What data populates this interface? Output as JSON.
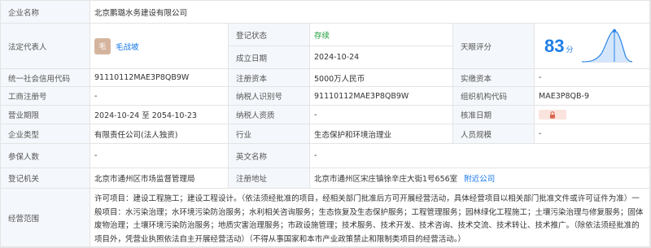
{
  "company": {
    "label": "企业名称",
    "name": "北京鹏璐水务建设有限公司"
  },
  "legal_rep": {
    "label": "法定代表人",
    "avatar_char": "毛",
    "name": "毛战坡"
  },
  "reg_status": {
    "label": "登记状态",
    "value": "存续"
  },
  "founded": {
    "label": "成立日期",
    "value": "2024-10-24"
  },
  "rating": {
    "label": "天眼评分",
    "score": "83",
    "unit": "分"
  },
  "credit_code": {
    "label": "统一社会信用代码",
    "value": "91110112MAE3P8QB9W"
  },
  "reg_capital": {
    "label": "注册资本",
    "value": "5000万人民币"
  },
  "paid_capital": {
    "label": "实缴资本",
    "value": "-"
  },
  "biz_reg_no": {
    "label": "工商注册号",
    "value": "-"
  },
  "taxpayer_id": {
    "label": "纳税人识别号",
    "value": "91110112MAE3P8QB9W"
  },
  "org_code": {
    "label": "组织机构代码",
    "value": "MAE3P8QB-9"
  },
  "biz_term": {
    "label": "营业期限",
    "value": "2024-10-24 至 2054-10-23"
  },
  "taxpayer_qual": {
    "label": "纳税人资质",
    "value": "-"
  },
  "approval_date": {
    "label": "核准日期"
  },
  "company_type": {
    "label": "企业类型",
    "value": "有限责任公司(法人独资)"
  },
  "industry": {
    "label": "行业",
    "value": "生态保护和环境治理业"
  },
  "staff_size": {
    "label": "人员规模",
    "value": "-"
  },
  "insured": {
    "label": "参保人数",
    "value": "-"
  },
  "english_name": {
    "label": "英文名称",
    "value": "-"
  },
  "authority": {
    "label": "登记机关",
    "value": "北京市通州区市场监督管理局"
  },
  "address": {
    "label": "注册地址",
    "value": "北京市通州区宋庄镇徐辛庄大街1号656室",
    "link": "附近公司"
  },
  "scope": {
    "label": "经营范围",
    "text": "许可项目：建设工程施工；建设工程设计。（依法须经批准的项目，经相关部门批准后方可开展经营活动，具体经营项目以相关部门批准文件或许可证件为准）一般项目：水污染治理；水环境污染防治服务；水利相关咨询服务；生态恢复及生态保护服务；工程管理服务；园林绿化工程施工；土壤污染治理与修复服务；固体废物治理；土壤环境污染防治服务；地质灾害治理服务；市政设施管理；技术服务、技术开发、技术咨询、技术交流、技术转让、技术推广。（除依法须经批准的项目外，凭营业执照依法自主开展经营活动）（不得从事国家和本市产业政策禁止和限制类项目的经营活动。）"
  },
  "colors": {
    "label_bg": "#f4f7fb",
    "border": "#e4e4e4",
    "status_green": "#1a9e3a",
    "link_blue": "#1476e8",
    "score_blue": "#1e7ee6"
  }
}
